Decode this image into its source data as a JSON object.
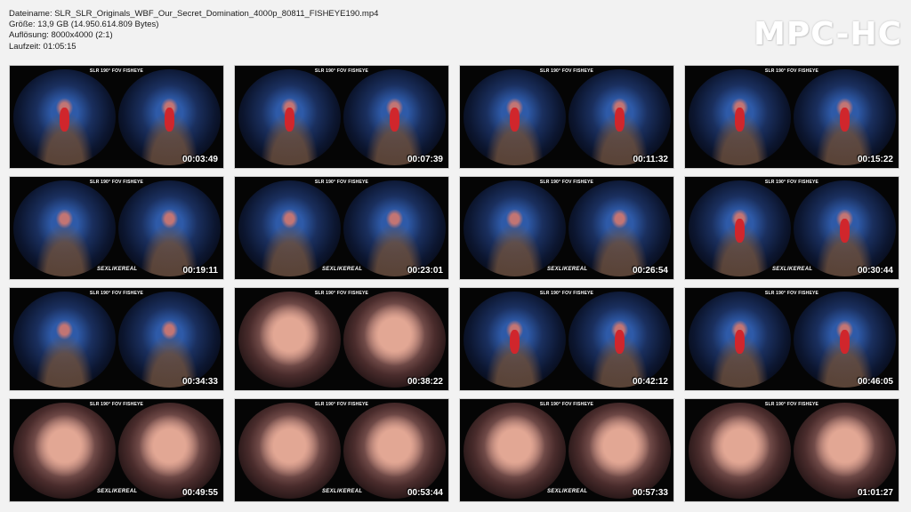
{
  "info": {
    "filename": "Dateiname: SLR_SLR_Originals_WBF_Our_Secret_Domination_4000p_80811_FISHEYE190.mp4",
    "size": "Größe: 13,9 GB (14.950.614.809 Bytes)",
    "resolution": "Auflösung: 8000x4000 (2:1)",
    "duration": "Laufzeit: 01:05:15"
  },
  "logo": "MPC-HC",
  "thumb_header": "SLR 190° FOV FISHEYE",
  "thumb_brand": "SEXLIKEREAL",
  "thumbnails": [
    {
      "time": "00:03:49",
      "brand": false,
      "style": "redp"
    },
    {
      "time": "00:07:39",
      "brand": false,
      "style": "redp"
    },
    {
      "time": "00:11:32",
      "brand": false,
      "style": "redp"
    },
    {
      "time": "00:15:22",
      "brand": false,
      "style": "redp"
    },
    {
      "time": "00:19:11",
      "brand": true,
      "style": ""
    },
    {
      "time": "00:23:01",
      "brand": true,
      "style": ""
    },
    {
      "time": "00:26:54",
      "brand": true,
      "style": ""
    },
    {
      "time": "00:30:44",
      "brand": true,
      "style": "redp"
    },
    {
      "time": "00:34:33",
      "brand": false,
      "style": ""
    },
    {
      "time": "00:38:22",
      "brand": false,
      "style": "warm"
    },
    {
      "time": "00:42:12",
      "brand": false,
      "style": "redp"
    },
    {
      "time": "00:46:05",
      "brand": false,
      "style": "redp"
    },
    {
      "time": "00:49:55",
      "brand": true,
      "style": "warm"
    },
    {
      "time": "00:53:44",
      "brand": true,
      "style": "warm"
    },
    {
      "time": "00:57:33",
      "brand": true,
      "style": "warm"
    },
    {
      "time": "01:01:27",
      "brand": false,
      "style": "warm"
    }
  ]
}
